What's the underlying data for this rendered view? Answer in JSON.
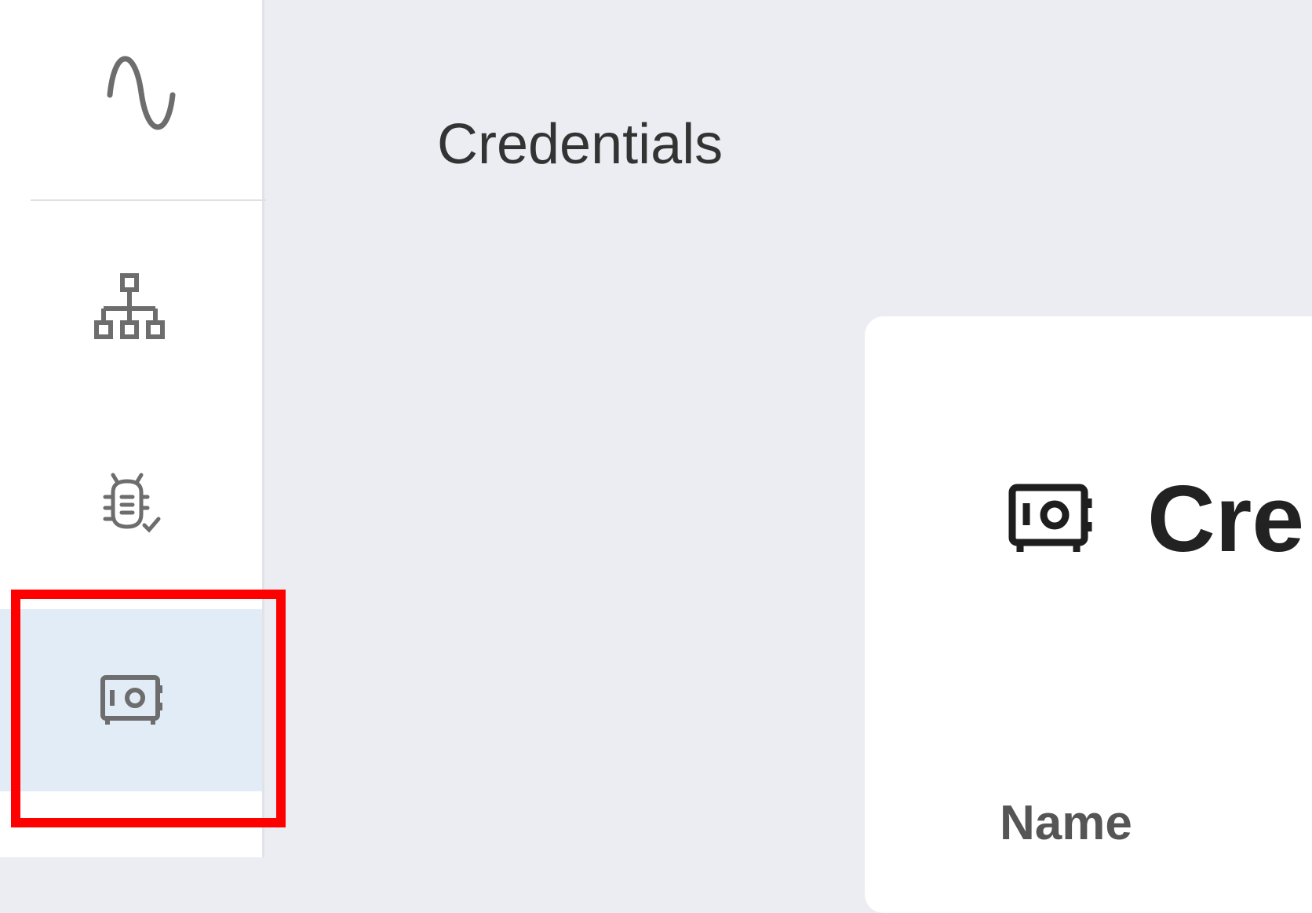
{
  "sidebar": {
    "logo": {
      "icon": "sine-wave-icon"
    },
    "items": [
      {
        "id": "workflows",
        "icon": "sitemap-icon",
        "active": false
      },
      {
        "id": "debug",
        "icon": "bug-check-icon",
        "active": false
      },
      {
        "id": "credentials",
        "icon": "vault-icon",
        "active": true
      }
    ]
  },
  "header": {
    "title": "Credentials"
  },
  "card": {
    "icon": "vault-icon",
    "title": "Cre",
    "field_label": "Name"
  },
  "colors": {
    "sidebar_bg": "#ffffff",
    "main_bg": "#ecedf2",
    "active_item_bg": "#e2ecf7",
    "icon_color": "#6d6d6d",
    "highlight": "#ff0000"
  }
}
